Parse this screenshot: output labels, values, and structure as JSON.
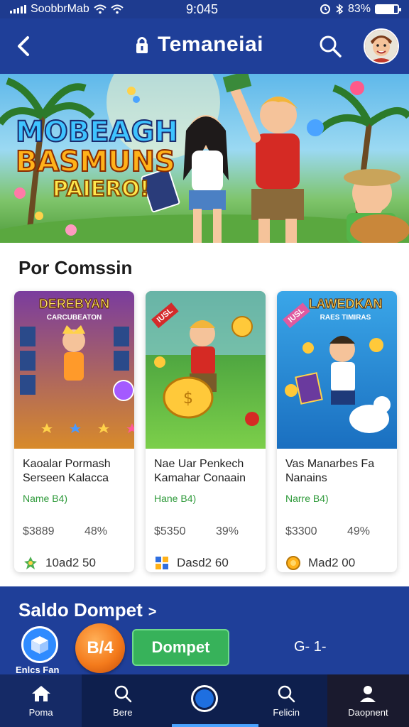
{
  "status_bar": {
    "carrier": "SoobbrMab",
    "time": "9:045",
    "battery_text": "83%",
    "battery_level": 0.83
  },
  "header": {
    "title": "Temaneiai",
    "back_icon": "chevron-left-icon",
    "lock_icon": "lock-icon",
    "search_icon": "search-icon",
    "avatar_icon": "user-avatar"
  },
  "hero": {
    "line1": "MOBEAGH",
    "line2": "BASMUNS",
    "line3": "PAIERO!"
  },
  "commission": {
    "title": "Por Comssin",
    "cards": [
      {
        "img_title": "DEREBYAN",
        "img_sub": "CARCUBEATON",
        "badge": "",
        "name": "Kaoalar Pormash Serseen Kalacca",
        "tag": "Name B4)",
        "price": "$3889",
        "percent": "48%",
        "foot_icon": "gem-cluster-icon",
        "foot_text": "10ad2 50",
        "bg_top": "#7a3c9e",
        "bg_bottom": "#d88a2a"
      },
      {
        "img_title": "",
        "img_sub": "",
        "badge": "IUSL",
        "name": "Nae Uar Penkech Kamahar Conaain",
        "tag": "Hane B4)",
        "price": "$5350",
        "percent": "39%",
        "foot_icon": "puzzle-icon",
        "foot_text": "Dasd2 60",
        "bg_top": "#2f8a3a",
        "bg_bottom": "#7ccf4a"
      },
      {
        "img_title": "LAWEDKAN",
        "img_sub": "RAES TIMIRAS",
        "badge": "IUSL",
        "name": "Vas Manarbes Fa Nanains",
        "tag": "Narre B4)",
        "price": "$3300",
        "percent": "49%",
        "foot_icon": "coin-icon",
        "foot_text": "Mad2 00",
        "bg_top": "#3aa6e8",
        "bg_bottom": "#1a6fc0"
      }
    ]
  },
  "wallet": {
    "title": "Saldo Dompet",
    "chevron": ">",
    "cube_label": "Enlcs Fan",
    "coin_text": "B/4",
    "button_label": "Dompet",
    "value": "G- 1-"
  },
  "nav": {
    "items": [
      {
        "label": "Poma",
        "icon": "home-icon"
      },
      {
        "label": "Bere",
        "icon": "search-icon"
      },
      {
        "label": "",
        "icon": "center-circle-icon"
      },
      {
        "label": "Felicin",
        "icon": "search-icon"
      },
      {
        "label": "Daopnent",
        "icon": "person-icon"
      }
    ]
  },
  "colors": {
    "primary": "#1f3f99",
    "nav_bg": "#0e1f4d",
    "accent_green": "#37b25a",
    "coin_orange": "#f47b1c",
    "tag_green": "#2e9a3a"
  }
}
